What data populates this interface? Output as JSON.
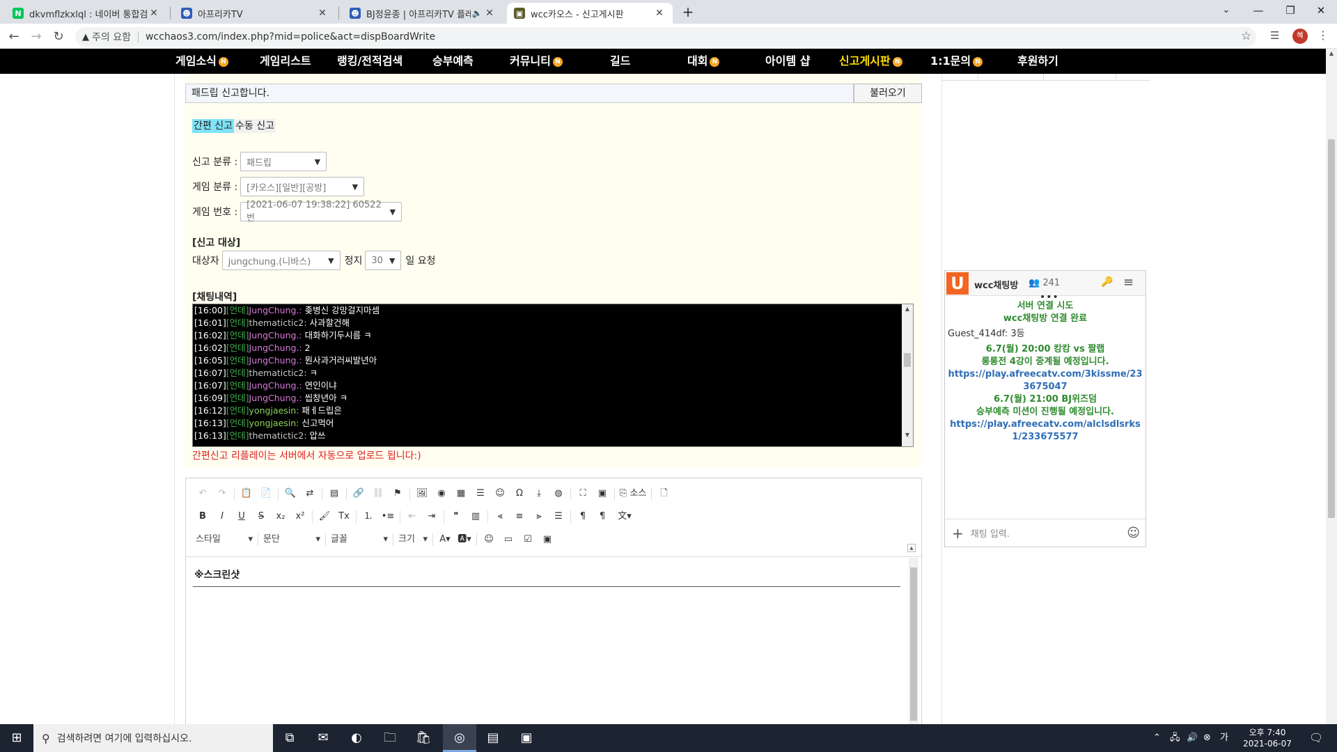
{
  "browser": {
    "tabs": [
      {
        "title": "dkvmflzkxlql : 네이버 통합검색",
        "fav": "N",
        "color": "#03c75a"
      },
      {
        "title": "아프리카TV",
        "fav": "☻",
        "color": "#2f5db8"
      },
      {
        "title": "BJ정윤종 | 아프리카TV 플레",
        "fav": "☻",
        "color": "#2f5db8"
      },
      {
        "title": "wcc카오스 - 신고게시판",
        "fav": "▣",
        "color": "#5b5b2a"
      }
    ],
    "unsafe": "주의 요함",
    "url": "wcchaos3.com/index.php?mid=police&act=dispBoardWrite",
    "profile": "혜"
  },
  "nav": [
    {
      "label": "게임소식",
      "badge": "N"
    },
    {
      "label": "게임리스트",
      "badge": ""
    },
    {
      "label": "랭킹/전적검색",
      "badge": ""
    },
    {
      "label": "승부예측",
      "badge": ""
    },
    {
      "label": "커뮤니티",
      "badge": "N"
    },
    {
      "label": "길드",
      "badge": ""
    },
    {
      "label": "대회",
      "badge": "N"
    },
    {
      "label": "아이템 샵",
      "badge": ""
    },
    {
      "label": "신고게시판",
      "badge": "N"
    },
    {
      "label": "1:1문의",
      "badge": "N"
    },
    {
      "label": "후원하기",
      "badge": ""
    }
  ],
  "form": {
    "title_value": "패드립 신고합니다.",
    "load_button": "불러오기",
    "mode_simple": "간편 신고",
    "mode_manual": "수동 신고",
    "category_label": "신고 분류 :",
    "category_value": "패드립",
    "game_type_label": "게임 분류 :",
    "game_type_value": "[카오스][일반][공방]",
    "game_no_label": "게임 번호 :",
    "game_no_value": "[2021-06-07 19:38:22] 60522번",
    "target_section": "[신고 대상]",
    "target_label": "대상자",
    "target_value": "jungchung.(니바스)",
    "ban_label": "정지",
    "ban_value": "30",
    "ban_suffix": "일 요청",
    "chat_section": "[채팅내역]",
    "notice": "간편신고 리플레이는 서버에서 자동으로 업로드 됩니다:)"
  },
  "chatlog": [
    {
      "t": "[16:00]",
      "tag": "[언데]",
      "u": "JungChung.:",
      "uc": "u1",
      "m": " 좆병신 강망걸지마셈"
    },
    {
      "t": "[16:01]",
      "tag": "[언데]",
      "u": "thematictic2:",
      "uc": "u2",
      "m": " 사과할건해"
    },
    {
      "t": "[16:02]",
      "tag": "[언데]",
      "u": "JungChung.:",
      "uc": "u1",
      "m": " 대화하기두시름 ㅋ"
    },
    {
      "t": "[16:02]",
      "tag": "[언데]",
      "u": "JungChung.:",
      "uc": "u1",
      "m": " 2"
    },
    {
      "t": "[16:05]",
      "tag": "[언데]",
      "u": "JungChung.:",
      "uc": "u1",
      "m": " 뭔사과거러씨발년아"
    },
    {
      "t": "[16:07]",
      "tag": "[언데]",
      "u": "thematictic2:",
      "uc": "u2",
      "m": " ㅋ"
    },
    {
      "t": "[16:07]",
      "tag": "[언데]",
      "u": "JungChung.:",
      "uc": "u1",
      "m": " 연인이냐"
    },
    {
      "t": "[16:09]",
      "tag": "[언데]",
      "u": "JungChung.:",
      "uc": "u1",
      "m": " 씹창년아 ㅋ"
    },
    {
      "t": "[16:12]",
      "tag": "[언데]",
      "u": "yongjaesin:",
      "uc": "u3",
      "m": " 패ㅔ드립은"
    },
    {
      "t": "[16:13]",
      "tag": "[언데]",
      "u": "yongjaesin:",
      "uc": "u3",
      "m": " 신고먹어"
    },
    {
      "t": "[16:13]",
      "tag": "[언데]",
      "u": "thematictic2:",
      "uc": "u2",
      "m": " 압쓰"
    }
  ],
  "editor": {
    "source_label": "소스",
    "style_combo": "스타일",
    "para_combo": "문단",
    "font_combo": "글꼴",
    "size_combo": "크기",
    "body_text": "※스크린샷"
  },
  "chat": {
    "room": "wcc채팅방",
    "users": "241",
    "sys1": "서버 연결 시도",
    "sys2": "wcc채팅방 연결 완료",
    "guest": "Guest_414df: 3등",
    "notice1a": "6.7(월) 20:00 캉캉 vs 짤랩",
    "notice1b": "롱롱전 4강이 중계될 예정입니다.",
    "link1": "https://play.afreecatv.com/3kissme/233675047",
    "notice2a": "6.7(월) 21:00 BJ위즈덤",
    "notice2b": "승부예측 미션이 진행될 예정입니다.",
    "link2": "https://play.afreecatv.com/alclsdlsrks1/233675577",
    "placeholder": "채팅 입력."
  },
  "taskbar": {
    "search": "검색하려면 여기에 입력하십시오.",
    "time": "오후 7:40",
    "date": "2021-06-07"
  }
}
